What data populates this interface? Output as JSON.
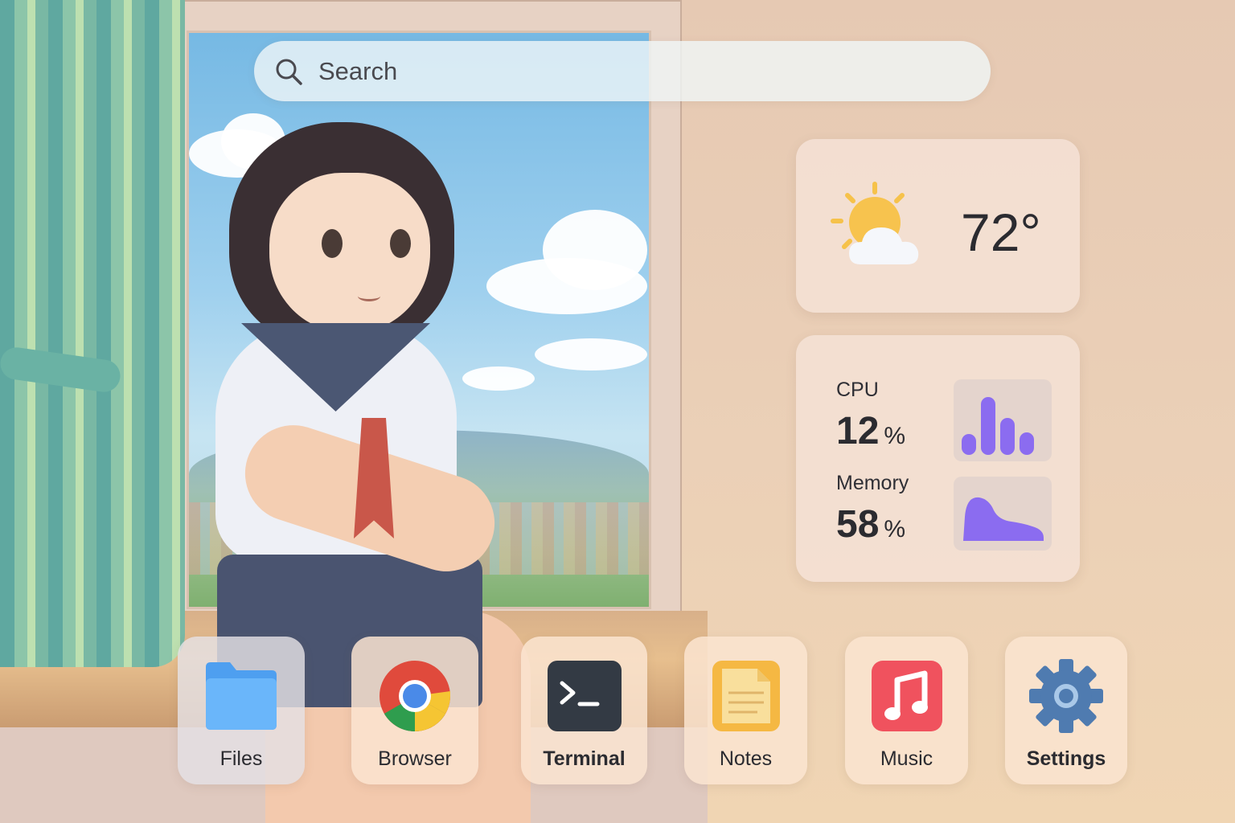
{
  "search": {
    "placeholder": "Search"
  },
  "weather": {
    "temperature": "72°",
    "icon": "sun-cloud-icon"
  },
  "system": {
    "cpu_label": "CPU",
    "cpu_value": "12",
    "cpu_unit": "%",
    "memory_label": "Memory",
    "memory_value": "58",
    "memory_unit": "%",
    "cpu_graph_icon": "bar-graph-icon",
    "memory_graph_icon": "area-graph-icon",
    "accent_color": "#8b6cf0"
  },
  "dock": {
    "items": [
      {
        "label": "Files",
        "icon": "folder-icon"
      },
      {
        "label": "Browser",
        "icon": "chrome-icon"
      },
      {
        "label": "Terminal",
        "icon": "terminal-icon"
      },
      {
        "label": "Notes",
        "icon": "notes-icon"
      },
      {
        "label": "Music",
        "icon": "music-note-icon"
      },
      {
        "label": "Settings",
        "icon": "gear-icon"
      }
    ]
  }
}
